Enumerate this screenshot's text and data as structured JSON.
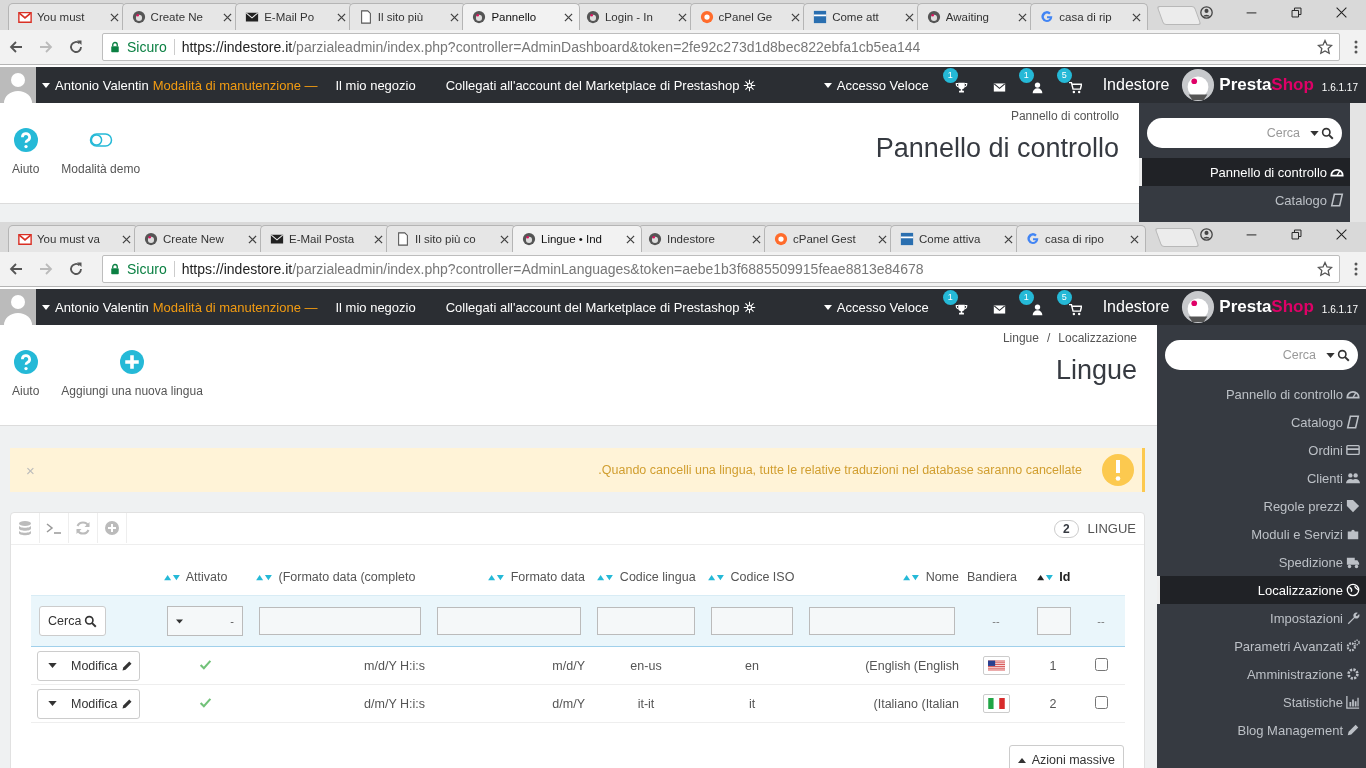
{
  "windows": [
    {
      "tabs": [
        {
          "label": "You must",
          "kind": "gmail",
          "selected": false
        },
        {
          "label": "Create Ne",
          "kind": "presta",
          "selected": false
        },
        {
          "label": "E-Mail Po",
          "kind": "mail",
          "selected": false
        },
        {
          "label": "Il sito più",
          "kind": "doc",
          "selected": false
        },
        {
          "label": "Pannello",
          "kind": "presta",
          "selected": true
        },
        {
          "label": "Login - In",
          "kind": "presta",
          "selected": false
        },
        {
          "label": "cPanel Ge",
          "kind": "cpanel",
          "selected": false
        },
        {
          "label": "Come att",
          "kind": "blue",
          "selected": false
        },
        {
          "label": "Awaiting",
          "kind": "presta",
          "selected": false
        },
        {
          "label": "casa di rip",
          "kind": "google",
          "selected": false
        }
      ],
      "address": {
        "secure": "Sicuro",
        "host": "https://indestore.it",
        "path": "/parzialeadmin/index.php?controller=AdminDashboard&token=2fe92c273d1d8bec822ebfa1cb5ea144"
      },
      "header": {
        "employee": "Antonio Valentin",
        "maintenance": "Modalità di manutenzione —",
        "shop": "Il mio negozio",
        "marketplace": "Collegati all'account del Marketplace di Prestashop",
        "quick_access": "Accesso Veloce",
        "notifications": [
          {
            "kind": "trophy",
            "count": "1"
          },
          {
            "kind": "mail"
          },
          {
            "kind": "user",
            "count": "1"
          },
          {
            "kind": "cart",
            "count": "5"
          }
        ],
        "shop_name": "Indestore",
        "logo_first": "Presta",
        "logo_second": "Shop",
        "version": "1.6.1.17"
      },
      "toolbar": [
        {
          "kind": "help",
          "label": "Aiuto"
        },
        {
          "kind": "toggle",
          "label": "Modalità demo"
        }
      ],
      "breadcrumb": [
        "Pannello di controllo"
      ],
      "title": "Pannello di controllo",
      "sidebar": {
        "search_placeholder": "Cerca",
        "items": [
          {
            "label": "Pannello di controllo",
            "kind": "gauge",
            "selected": true
          },
          {
            "label": "Catalogo",
            "kind": "book",
            "selected": false
          }
        ]
      }
    },
    {
      "tabs": [
        {
          "label": "You must va",
          "kind": "gmail",
          "selected": false
        },
        {
          "label": "Create New",
          "kind": "presta",
          "selected": false
        },
        {
          "label": "E-Mail Posta",
          "kind": "mail",
          "selected": false
        },
        {
          "label": "Il sito più co",
          "kind": "doc",
          "selected": false
        },
        {
          "label": "Lingue • Ind",
          "kind": "presta",
          "selected": true
        },
        {
          "label": "Indestore",
          "kind": "presta",
          "selected": false
        },
        {
          "label": "cPanel Gest",
          "kind": "cpanel",
          "selected": false
        },
        {
          "label": "Come attiva",
          "kind": "blue",
          "selected": false
        },
        {
          "label": "casa di ripo",
          "kind": "google",
          "selected": false
        }
      ],
      "address": {
        "secure": "Sicuro",
        "host": "https://indestore.it",
        "path": "/parzialeadmin/index.php?controller=AdminLanguages&token=aebe1b3f6885509915feae8813e84678"
      },
      "header": {
        "employee": "Antonio Valentin",
        "maintenance": "Modalità di manutenzione —",
        "shop": "Il mio negozio",
        "marketplace": "Collegati all'account del Marketplace di Prestashop",
        "quick_access": "Accesso Veloce",
        "notifications": [
          {
            "kind": "trophy",
            "count": "1"
          },
          {
            "kind": "mail"
          },
          {
            "kind": "user",
            "count": "1"
          },
          {
            "kind": "cart",
            "count": "5"
          }
        ],
        "shop_name": "Indestore",
        "logo_first": "Presta",
        "logo_second": "Shop",
        "version": "1.6.1.17"
      },
      "toolbar": [
        {
          "kind": "help",
          "label": "Aiuto"
        },
        {
          "kind": "add",
          "label": "Aggiungi una nuova lingua"
        }
      ],
      "breadcrumb": [
        "Lingue",
        "Localizzazione"
      ],
      "breadcrumb_separator": "/",
      "title": "Lingue",
      "alert": {
        "dismiss": "×",
        "text": ".Quando cancelli una lingua, tutte le relative traduzioni nel database saranno cancellate"
      },
      "panel": {
        "count": "2",
        "heading": "LINGUE",
        "columns": [
          {
            "label": "Attivato",
            "sortable": true,
            "sorted": false
          },
          {
            "label": "(Formato data (completo",
            "sortable": true,
            "sorted": false
          },
          {
            "label": "Formato data",
            "sortable": true,
            "sorted": false
          },
          {
            "label": "Codice lingua",
            "sortable": true,
            "sorted": false
          },
          {
            "label": "Codice ISO",
            "sortable": true,
            "sorted": false
          },
          {
            "label": "Nome",
            "sortable": true,
            "sorted": false
          },
          {
            "label": "Bandiera",
            "sortable": false,
            "sorted": false
          },
          {
            "label": "Id",
            "sortable": true,
            "sorted": true
          }
        ],
        "filters": [
          {
            "kind": "button",
            "label": "Cerca"
          },
          {
            "kind": "select",
            "value": "-"
          },
          {
            "kind": "input"
          },
          {
            "kind": "input"
          },
          {
            "kind": "input"
          },
          {
            "kind": "input"
          },
          {
            "kind": "input"
          },
          {
            "kind": "text",
            "text": "--"
          },
          {
            "kind": "input"
          },
          {
            "kind": "text",
            "text": "--"
          }
        ],
        "rows": [
          {
            "action": "Modifica",
            "active": true,
            "date_full": "m/d/Y H:i:s",
            "date": "m/d/Y",
            "lang_code": "en-us",
            "iso": "en",
            "name": "(English (English",
            "kind": "us",
            "id": "1",
            "checked": false
          },
          {
            "action": "Modifica",
            "active": true,
            "date_full": "d/m/Y H:i:s",
            "date": "d/m/Y",
            "lang_code": "it-it",
            "iso": "it",
            "name": "(Italiano (Italian",
            "kind": "it",
            "id": "2",
            "checked": false
          }
        ],
        "bulk_action": "Azioni massive"
      },
      "sidebar": {
        "search_placeholder": "Cerca",
        "items": [
          {
            "label": "Pannello di controllo",
            "kind": "gauge",
            "selected": false
          },
          {
            "label": "Catalogo",
            "kind": "book",
            "selected": false
          },
          {
            "label": "Ordini",
            "kind": "card",
            "selected": false
          },
          {
            "label": "Clienti",
            "kind": "users",
            "selected": false
          },
          {
            "label": "Regole prezzi",
            "kind": "tag",
            "selected": false
          },
          {
            "label": "Moduli e Servizi",
            "kind": "puzzle",
            "selected": false
          },
          {
            "label": "Spedizione",
            "kind": "truck",
            "selected": false
          },
          {
            "label": "Localizzazione",
            "kind": "globe",
            "selected": true
          },
          {
            "label": "Impostazioni",
            "kind": "wrench",
            "selected": false
          },
          {
            "label": "Parametri Avanzati",
            "kind": "gears",
            "selected": false
          },
          {
            "label": "Amministrazione",
            "kind": "gear",
            "selected": false
          },
          {
            "label": "Statistiche",
            "kind": "chart",
            "selected": false
          },
          {
            "label": "Blog Management",
            "kind": "pencil",
            "selected": false
          }
        ]
      }
    }
  ]
}
